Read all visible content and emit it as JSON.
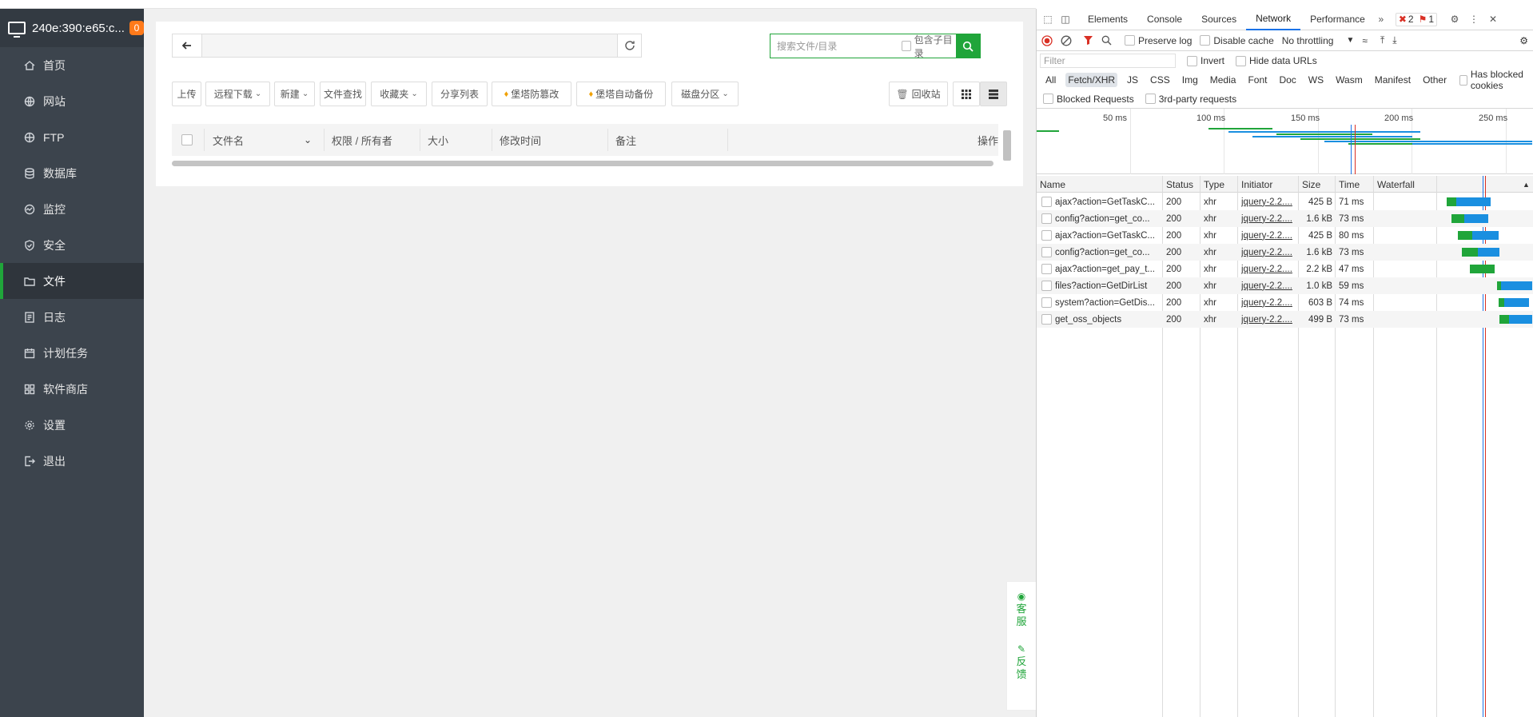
{
  "sidebar": {
    "host": "240e:390:e65:c...",
    "badge": "0",
    "items": [
      {
        "label": "首页",
        "icon": "home-icon"
      },
      {
        "label": "网站",
        "icon": "globe-icon"
      },
      {
        "label": "FTP",
        "icon": "ftp-icon"
      },
      {
        "label": "数据库",
        "icon": "database-icon"
      },
      {
        "label": "监控",
        "icon": "monitor-icon"
      },
      {
        "label": "安全",
        "icon": "shield-icon"
      },
      {
        "label": "文件",
        "icon": "folder-icon"
      },
      {
        "label": "日志",
        "icon": "log-icon"
      },
      {
        "label": "计划任务",
        "icon": "calendar-icon"
      },
      {
        "label": "软件商店",
        "icon": "apps-icon"
      },
      {
        "label": "设置",
        "icon": "gear-icon"
      },
      {
        "label": "退出",
        "icon": "logout-icon"
      }
    ],
    "active": "文件"
  },
  "files": {
    "search_placeholder": "搜索文件/目录",
    "include_subdir": "包含子目录",
    "toolbar": {
      "upload": "上传",
      "remote_download": "远程下载",
      "new": "新建",
      "find": "文件查找",
      "favorites": "收藏夹",
      "share_list": "分享列表",
      "tamper": "堡塔防篡改",
      "auto_backup": "堡塔自动备份",
      "disk": "磁盘分区",
      "recycle": "回收站"
    },
    "columns": {
      "name": "文件名",
      "perm": "权限 / 所有者",
      "size": "大小",
      "mtime": "修改时间",
      "note": "备注",
      "ops": "操作"
    }
  },
  "float_help": {
    "service": [
      "客",
      "服"
    ],
    "feedback": [
      "反",
      "馈"
    ]
  },
  "devtools": {
    "tabs": [
      "Elements",
      "Console",
      "Sources",
      "Network",
      "Performance"
    ],
    "active_tab": "Network",
    "errors": "2",
    "warnings": "1",
    "preserve_log": "Preserve log",
    "disable_cache": "Disable cache",
    "throttling": "No throttling",
    "filter_placeholder": "Filter",
    "invert": "Invert",
    "hide_data_urls": "Hide data URLs",
    "types": [
      "All",
      "Fetch/XHR",
      "JS",
      "CSS",
      "Img",
      "Media",
      "Font",
      "Doc",
      "WS",
      "Wasm",
      "Manifest",
      "Other"
    ],
    "selected_type": "Fetch/XHR",
    "has_blocked_cookies": "Has blocked cookies",
    "blocked_requests": "Blocked Requests",
    "third_party": "3rd-party requests",
    "overview_ticks": [
      "50 ms",
      "100 ms",
      "150 ms",
      "200 ms",
      "250 ms"
    ],
    "headers": {
      "name": "Name",
      "status": "Status",
      "type": "Type",
      "initiator": "Initiator",
      "size": "Size",
      "time": "Time",
      "waterfall": "Waterfall"
    },
    "requests": [
      {
        "name": "ajax?action=GetTaskC...",
        "status": "200",
        "type": "xhr",
        "initiator": "jquery-2.2....",
        "size": "425 B",
        "time": "71 ms",
        "wf_green": [
          0.58,
          0.1
        ],
        "wf_blue": [
          0.66,
          0.28
        ]
      },
      {
        "name": "config?action=get_co...",
        "status": "200",
        "type": "xhr",
        "initiator": "jquery-2.2....",
        "size": "1.6 kB",
        "time": "73 ms",
        "wf_green": [
          0.62,
          0.1
        ],
        "wf_blue": [
          0.72,
          0.2
        ]
      },
      {
        "name": "ajax?action=GetTaskC...",
        "status": "200",
        "type": "xhr",
        "initiator": "jquery-2.2....",
        "size": "425 B",
        "time": "80 ms",
        "wf_green": [
          0.67,
          0.12
        ],
        "wf_blue": [
          0.79,
          0.21
        ]
      },
      {
        "name": "config?action=get_co...",
        "status": "200",
        "type": "xhr",
        "initiator": "jquery-2.2....",
        "size": "1.6 kB",
        "time": "73 ms",
        "wf_green": [
          0.7,
          0.13
        ],
        "wf_blue": [
          0.83,
          0.18
        ]
      },
      {
        "name": "ajax?action=get_pay_t...",
        "status": "200",
        "type": "xhr",
        "initiator": "jquery-2.2....",
        "size": "2.2 kB",
        "time": "47 ms",
        "wf_green": [
          0.77,
          0.2
        ],
        "wf_blue": [
          0.97,
          0.0
        ]
      },
      {
        "name": "files?action=GetDirList",
        "status": "200",
        "type": "xhr",
        "initiator": "jquery-2.2....",
        "size": "1.0 kB",
        "time": "59 ms",
        "wf_green": [
          0.99,
          0.03
        ],
        "wf_blue": [
          1.02,
          0.26
        ]
      },
      {
        "name": "system?action=GetDis...",
        "status": "200",
        "type": "xhr",
        "initiator": "jquery-2.2....",
        "size": "603 B",
        "time": "74 ms",
        "wf_green": [
          1.0,
          0.05
        ],
        "wf_blue": [
          1.05,
          0.2
        ]
      },
      {
        "name": "get_oss_objects",
        "status": "200",
        "type": "xhr",
        "initiator": "jquery-2.2....",
        "size": "499 B",
        "time": "73 ms",
        "wf_green": [
          1.01,
          0.08
        ],
        "wf_blue": [
          1.09,
          0.2
        ]
      }
    ]
  }
}
